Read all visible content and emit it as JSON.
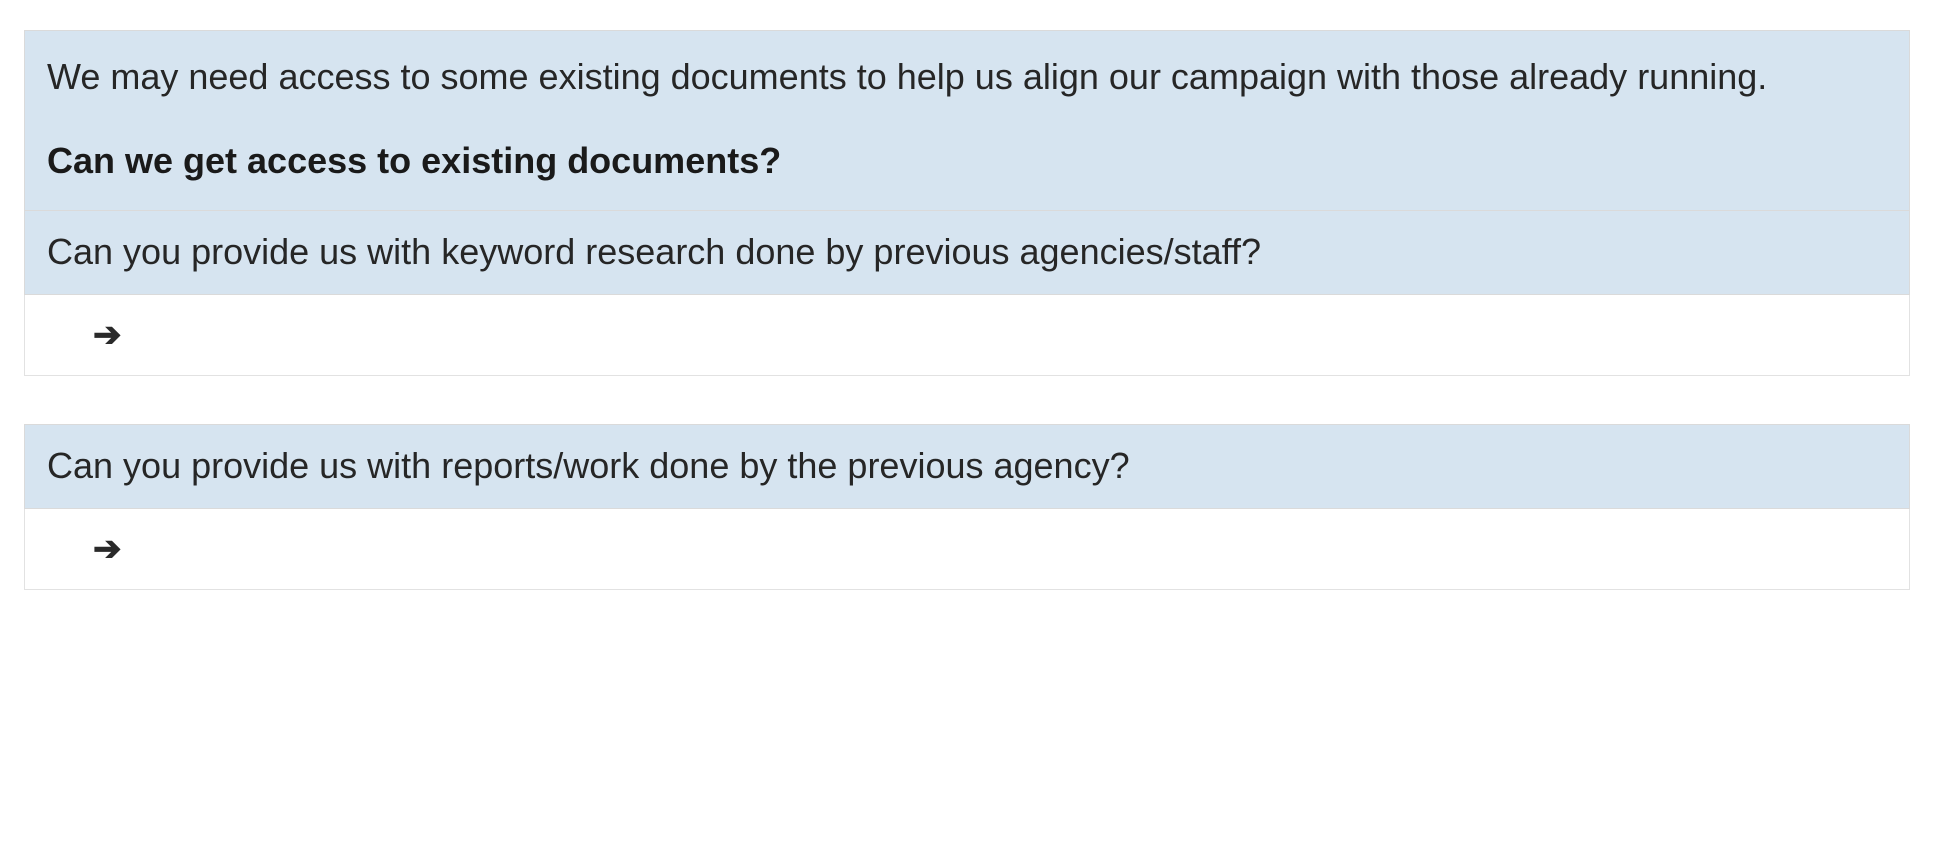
{
  "section1": {
    "intro": "We may need access to some existing documents to help us align our campaign with those already running.",
    "bold_question": "Can we get access to existing documents?",
    "sub_question": "Can you provide us with keyword research done by previous agencies/staff?",
    "arrow": "➔"
  },
  "section2": {
    "question": "Can you provide us with reports/work done by the previous agency?",
    "arrow": "➔"
  }
}
